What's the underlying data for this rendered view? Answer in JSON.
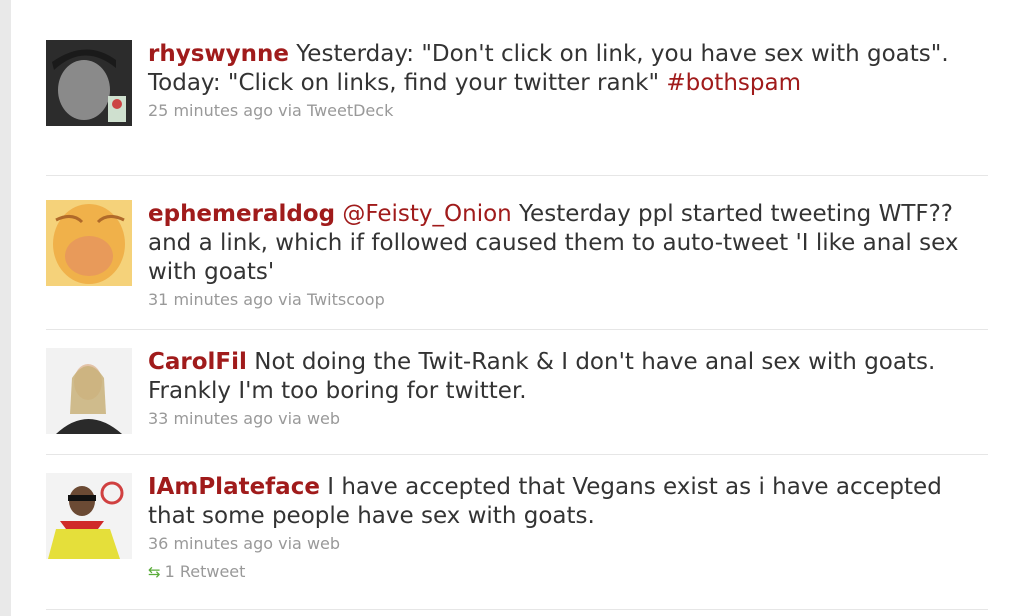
{
  "tweets": [
    {
      "author": "rhyswynne",
      "text_before": " Yesterday: \"Don't click on link, you have sex with goats\". Today: \"Click on links, find your twitter rank\" ",
      "hashtag": "#bothspam",
      "meta": "25 minutes ago via TweetDeck"
    },
    {
      "author": "ephemeraldog",
      "mention": "@Feisty_Onion",
      "text_after": " Yesterday ppl started tweeting WTF?? and a link, which if followed caused them to auto-tweet 'I like anal sex with goats'",
      "meta": "31 minutes ago via Twitscoop"
    },
    {
      "author": "CarolFil",
      "text_after": " Not doing the Twit-Rank & I don't have anal sex with goats. Frankly I'm too boring for twitter.",
      "meta": "33 minutes ago via web"
    },
    {
      "author": "IAmPlateface",
      "text_after": " I have accepted that Vegans exist as i have accepted that some people have sex with goats.",
      "meta": "36 minutes ago via web",
      "retweet_icon": "retweet-icon",
      "retweet_label": "1 Retweet"
    }
  ],
  "colors": {
    "author": "#a01b1b",
    "meta": "#999999",
    "retweet": "#5aab3a"
  }
}
